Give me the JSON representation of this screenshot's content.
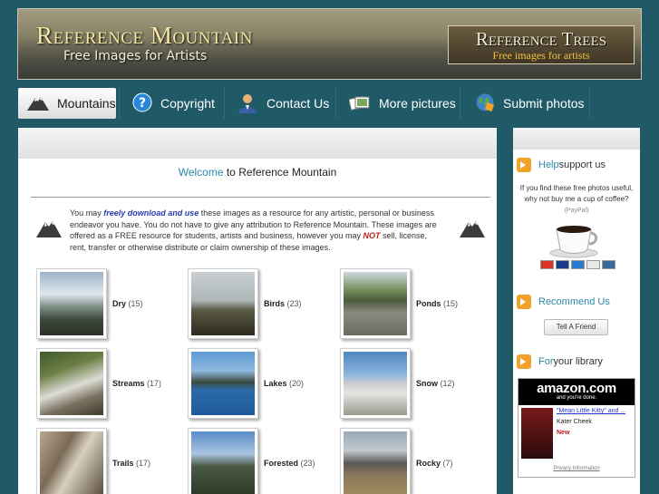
{
  "header": {
    "title": "Reference Mountain",
    "subtitle": "Free Images for Artists",
    "ad_title": "Reference Trees",
    "ad_subtitle": "Free images for artists"
  },
  "nav": {
    "items": [
      {
        "label": "Mountains",
        "icon": "mountain-icon"
      },
      {
        "label": "Copyright",
        "icon": "question-icon"
      },
      {
        "label": "Contact Us",
        "icon": "person-icon"
      },
      {
        "label": "More pictures",
        "icon": "photos-icon"
      },
      {
        "label": "Submit photos",
        "icon": "globe-icon"
      }
    ]
  },
  "main": {
    "welcome_hl": "Welcome",
    "welcome_rest": " to Reference Mountain",
    "intro": {
      "p1": "You may ",
      "em1": "freely download and use",
      "p2": " these images as a resource for any artistic, personal or business endeavor you have. You do not have to give any attribution to Reference Mountain. These images are offered as a FREE resource for students, artists and business, however you may ",
      "em2": "NOT",
      "p3": " sell, license, rent, transfer or otherwise distribute or claim ownership of these images."
    },
    "categories": [
      {
        "name": "Dry",
        "count": "(15)"
      },
      {
        "name": "Birds",
        "count": "(23)"
      },
      {
        "name": "Ponds",
        "count": "(15)"
      },
      {
        "name": "Streams",
        "count": "(17)"
      },
      {
        "name": "Lakes",
        "count": "(20)"
      },
      {
        "name": "Snow",
        "count": "(12)"
      },
      {
        "name": "Trails",
        "count": "(17)"
      },
      {
        "name": "Forested",
        "count": "(23)"
      },
      {
        "name": "Rocky",
        "count": "(7)"
      }
    ]
  },
  "sidebar": {
    "help_hl": "Help",
    "help_rest": " support us",
    "help_text": "If you find these free photos useful, why not buy me a cup of coffee?",
    "paypal": "(PayPal)",
    "recommend": "Recommend Us",
    "tell_friend": "Tell A Friend",
    "library_hl": "For",
    "library_rest": " your library",
    "amazon": {
      "logo": "amazon.com",
      "tagline": "and you're done.",
      "book_link": "\"Mean Little Kitty\" and ...",
      "author": "Kater Cheek",
      "new_label": "New",
      "privacy": "Privacy Information"
    }
  },
  "colors": {
    "background": "#1f5a66",
    "accent": "#2b8aa8",
    "warning": "#c0201a"
  }
}
